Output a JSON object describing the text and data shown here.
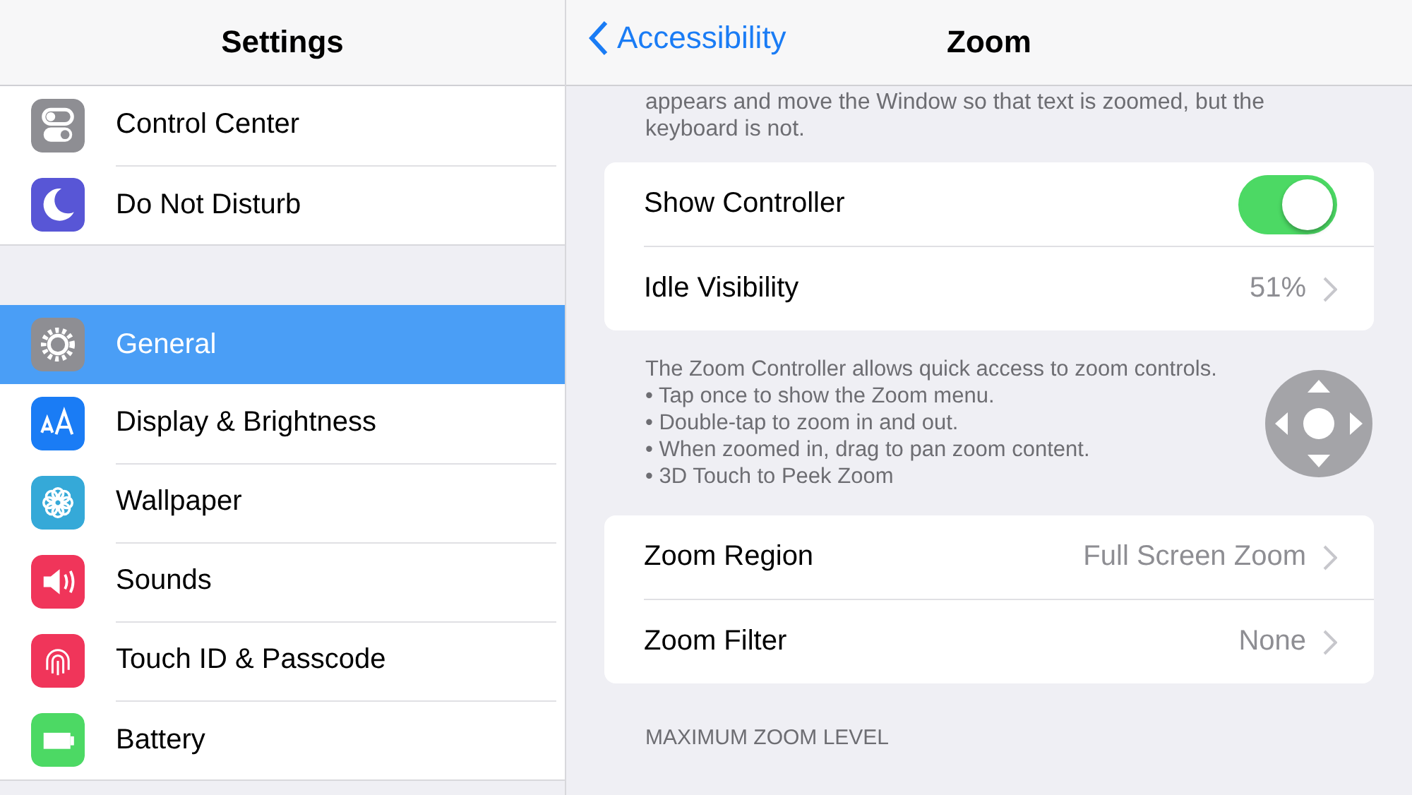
{
  "sidebar": {
    "title": "Settings",
    "groups": [
      [
        {
          "label": "Control Center",
          "color": "#8e8e93",
          "selected": false
        },
        {
          "label": "Do Not Disturb",
          "color": "#5856d6",
          "selected": false
        }
      ],
      [
        {
          "label": "General",
          "color": "#8e8e93",
          "selected": true
        },
        {
          "label": "Display & Brightness",
          "color": "#1a7cf5",
          "selected": false
        },
        {
          "label": "Wallpaper",
          "color": "#35a9d8",
          "selected": false
        },
        {
          "label": "Sounds",
          "color": "#f0355a",
          "selected": false
        },
        {
          "label": "Touch ID & Passcode",
          "color": "#f0355a",
          "selected": false
        },
        {
          "label": "Battery",
          "color": "#4cd964",
          "selected": false
        }
      ]
    ]
  },
  "detail": {
    "back": "Accessibility",
    "title": "Zoom",
    "intro": "appears and move the Window so that text is zoomed, but the keyboard is not.",
    "card1": [
      {
        "kind": "toggle",
        "label": "Show Controller",
        "on": true
      },
      {
        "kind": "value",
        "label": "Idle Visibility",
        "value": "51%"
      }
    ],
    "description": [
      "The Zoom Controller allows quick access to zoom controls.",
      "• Tap once to show the Zoom menu.",
      "• Double-tap to zoom in and out.",
      "• When zoomed in, drag to pan zoom content.",
      "• 3D Touch to Peek Zoom"
    ],
    "card2": [
      {
        "kind": "value",
        "label": "Zoom Region",
        "value": "Full Screen Zoom"
      },
      {
        "kind": "value",
        "label": "Zoom Filter",
        "value": "None"
      }
    ],
    "section": "MAXIMUM ZOOM LEVEL"
  }
}
